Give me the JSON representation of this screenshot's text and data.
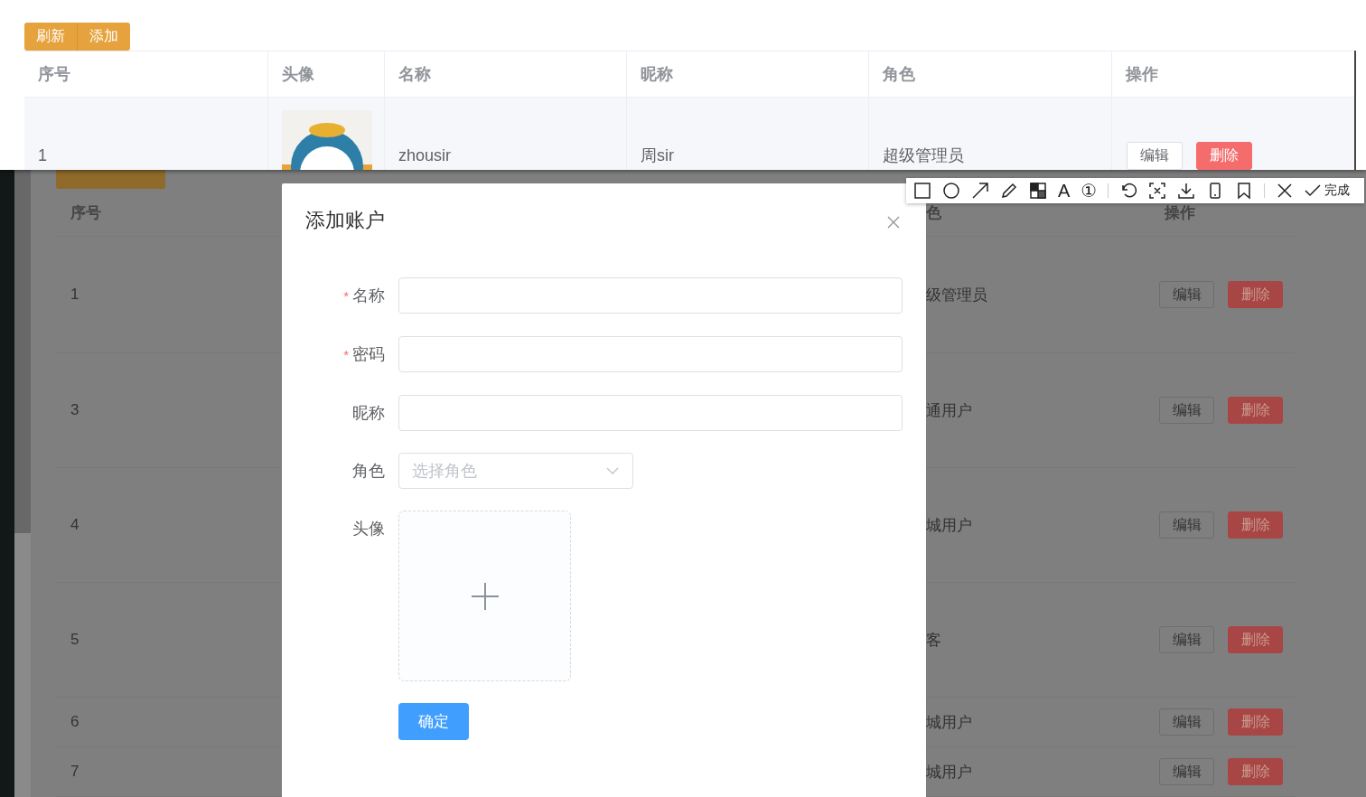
{
  "snapshot": {
    "toolbar_buttons": [
      "刷新",
      "添加"
    ],
    "columns": [
      "序号",
      "头像",
      "名称",
      "昵称",
      "角色",
      "操作"
    ],
    "rows": [
      {
        "index": "1",
        "avatar": {
          "kind": "picture"
        },
        "name": "zhousir",
        "nickname": "周sir",
        "role": "超级管理员",
        "actions": [
          "编辑",
          "删除"
        ]
      }
    ]
  },
  "background": {
    "columns": [
      "序号",
      "色",
      "操作"
    ],
    "rows": [
      {
        "index": "1",
        "role": "级管理员",
        "actions": [
          "编辑",
          "删除"
        ]
      },
      {
        "index": "3",
        "role": "通用户",
        "actions": [
          "编辑",
          "删除"
        ]
      },
      {
        "index": "4",
        "role": "城用户",
        "actions": [
          "编辑",
          "删除"
        ]
      },
      {
        "index": "5",
        "role": "客",
        "actions": [
          "编辑",
          "删除"
        ]
      },
      {
        "index": "6",
        "role": "城用户",
        "actions": [
          "编辑",
          "删除"
        ]
      },
      {
        "index": "7",
        "role": "城用户",
        "actions": [
          "编辑",
          "删除"
        ]
      }
    ]
  },
  "dialog": {
    "title": "添加账户",
    "fields": [
      {
        "label": "名称",
        "marker": "*",
        "kind": "input"
      },
      {
        "label": "密码",
        "marker": "*",
        "kind": "input"
      },
      {
        "label": "昵称",
        "kind": "input"
      },
      {
        "label": "角色",
        "kind": "select",
        "placeholder": "选择角色"
      },
      {
        "label": "头像",
        "kind": "upload"
      }
    ],
    "submit": "确定"
  },
  "capture_toolbar": {
    "tools": [
      {
        "kind": "rect"
      },
      {
        "kind": "ellipse"
      },
      {
        "kind": "arrow"
      },
      {
        "kind": "pen"
      },
      {
        "kind": "mosaic"
      },
      {
        "kind": "text",
        "glyph": "A"
      },
      {
        "kind": "number",
        "glyph": "①"
      },
      {
        "kind": "separator"
      },
      {
        "kind": "undo"
      },
      {
        "kind": "fit"
      },
      {
        "kind": "download"
      },
      {
        "kind": "phone"
      },
      {
        "kind": "bookmark"
      },
      {
        "kind": "separator"
      },
      {
        "kind": "close"
      }
    ],
    "done": "完成"
  }
}
